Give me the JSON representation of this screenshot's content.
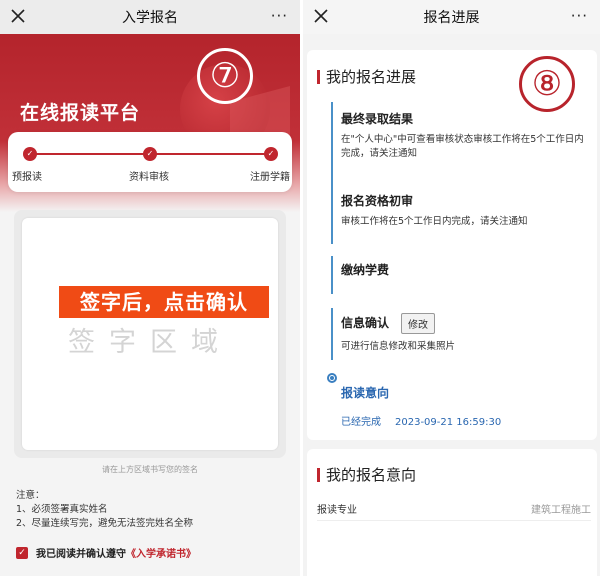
{
  "left": {
    "nav": {
      "title": "入学报名",
      "more": "···"
    },
    "banner": {
      "platform_title": "在线报读平台",
      "marker": "⑦"
    },
    "steps": [
      {
        "label": "预报读"
      },
      {
        "label": "资料审核"
      },
      {
        "label": "注册学籍"
      }
    ],
    "signature": {
      "overlay_text": "签字后，点击确认",
      "area_text": "签字区域",
      "hint": "请在上方区域书写您的签名"
    },
    "notes": {
      "title": "注意：",
      "items": [
        "1、必须签署真实姓名",
        "2、尽量连续写完，避免无法签完姓名全称"
      ]
    },
    "agreement": {
      "text": "我已阅读并确认遵守",
      "link": "《入学承诺书》"
    }
  },
  "right": {
    "nav": {
      "title": "报名进展",
      "more": "···"
    },
    "marker": "⑧",
    "progress": {
      "title": "我的报名进展",
      "items": [
        {
          "title": "最终录取结果",
          "desc": "在\"个人中心\"中可查看审核状态审核工作将在5个工作日内完成，请关注通知"
        },
        {
          "title": "报名资格初审",
          "desc": "审核工作将在5个工作日内完成，请关注通知"
        },
        {
          "title": "缴纳学费"
        },
        {
          "title": "信息确认",
          "button": "修改",
          "desc": "可进行信息修改和采集照片"
        },
        {
          "title": "报读意向",
          "status": "已经完成",
          "time": "2023-09-21 16:59:30"
        }
      ]
    },
    "intent": {
      "title": "我的报名意向",
      "major_label": "报读专业",
      "major_value": "建筑工程施工"
    }
  },
  "colors": {
    "brand_red": "#c0262e",
    "timeline_blue": "#2a67b0",
    "overlay_orange": "#f04b15"
  }
}
